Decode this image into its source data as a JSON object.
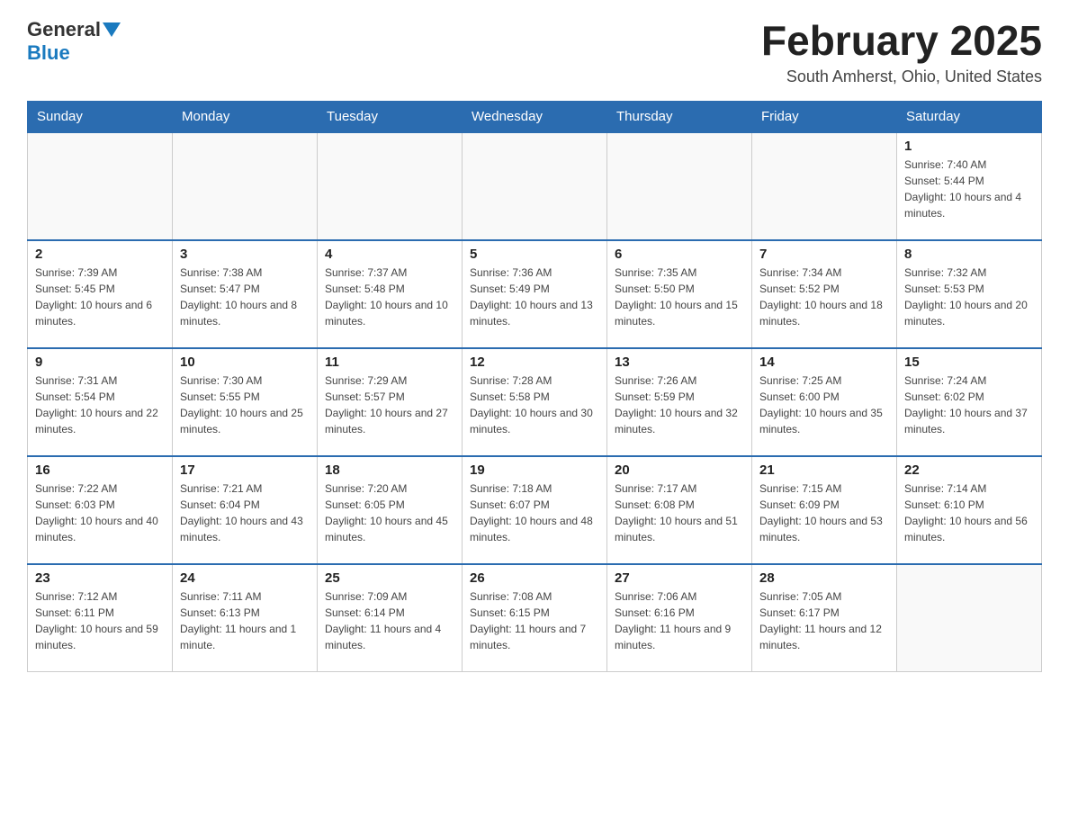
{
  "header": {
    "logo_general": "General",
    "logo_blue": "Blue",
    "month_title": "February 2025",
    "location": "South Amherst, Ohio, United States"
  },
  "weekdays": [
    "Sunday",
    "Monday",
    "Tuesday",
    "Wednesday",
    "Thursday",
    "Friday",
    "Saturday"
  ],
  "weeks": [
    [
      {
        "day": "",
        "info": ""
      },
      {
        "day": "",
        "info": ""
      },
      {
        "day": "",
        "info": ""
      },
      {
        "day": "",
        "info": ""
      },
      {
        "day": "",
        "info": ""
      },
      {
        "day": "",
        "info": ""
      },
      {
        "day": "1",
        "info": "Sunrise: 7:40 AM\nSunset: 5:44 PM\nDaylight: 10 hours and 4 minutes."
      }
    ],
    [
      {
        "day": "2",
        "info": "Sunrise: 7:39 AM\nSunset: 5:45 PM\nDaylight: 10 hours and 6 minutes."
      },
      {
        "day": "3",
        "info": "Sunrise: 7:38 AM\nSunset: 5:47 PM\nDaylight: 10 hours and 8 minutes."
      },
      {
        "day": "4",
        "info": "Sunrise: 7:37 AM\nSunset: 5:48 PM\nDaylight: 10 hours and 10 minutes."
      },
      {
        "day": "5",
        "info": "Sunrise: 7:36 AM\nSunset: 5:49 PM\nDaylight: 10 hours and 13 minutes."
      },
      {
        "day": "6",
        "info": "Sunrise: 7:35 AM\nSunset: 5:50 PM\nDaylight: 10 hours and 15 minutes."
      },
      {
        "day": "7",
        "info": "Sunrise: 7:34 AM\nSunset: 5:52 PM\nDaylight: 10 hours and 18 minutes."
      },
      {
        "day": "8",
        "info": "Sunrise: 7:32 AM\nSunset: 5:53 PM\nDaylight: 10 hours and 20 minutes."
      }
    ],
    [
      {
        "day": "9",
        "info": "Sunrise: 7:31 AM\nSunset: 5:54 PM\nDaylight: 10 hours and 22 minutes."
      },
      {
        "day": "10",
        "info": "Sunrise: 7:30 AM\nSunset: 5:55 PM\nDaylight: 10 hours and 25 minutes."
      },
      {
        "day": "11",
        "info": "Sunrise: 7:29 AM\nSunset: 5:57 PM\nDaylight: 10 hours and 27 minutes."
      },
      {
        "day": "12",
        "info": "Sunrise: 7:28 AM\nSunset: 5:58 PM\nDaylight: 10 hours and 30 minutes."
      },
      {
        "day": "13",
        "info": "Sunrise: 7:26 AM\nSunset: 5:59 PM\nDaylight: 10 hours and 32 minutes."
      },
      {
        "day": "14",
        "info": "Sunrise: 7:25 AM\nSunset: 6:00 PM\nDaylight: 10 hours and 35 minutes."
      },
      {
        "day": "15",
        "info": "Sunrise: 7:24 AM\nSunset: 6:02 PM\nDaylight: 10 hours and 37 minutes."
      }
    ],
    [
      {
        "day": "16",
        "info": "Sunrise: 7:22 AM\nSunset: 6:03 PM\nDaylight: 10 hours and 40 minutes."
      },
      {
        "day": "17",
        "info": "Sunrise: 7:21 AM\nSunset: 6:04 PM\nDaylight: 10 hours and 43 minutes."
      },
      {
        "day": "18",
        "info": "Sunrise: 7:20 AM\nSunset: 6:05 PM\nDaylight: 10 hours and 45 minutes."
      },
      {
        "day": "19",
        "info": "Sunrise: 7:18 AM\nSunset: 6:07 PM\nDaylight: 10 hours and 48 minutes."
      },
      {
        "day": "20",
        "info": "Sunrise: 7:17 AM\nSunset: 6:08 PM\nDaylight: 10 hours and 51 minutes."
      },
      {
        "day": "21",
        "info": "Sunrise: 7:15 AM\nSunset: 6:09 PM\nDaylight: 10 hours and 53 minutes."
      },
      {
        "day": "22",
        "info": "Sunrise: 7:14 AM\nSunset: 6:10 PM\nDaylight: 10 hours and 56 minutes."
      }
    ],
    [
      {
        "day": "23",
        "info": "Sunrise: 7:12 AM\nSunset: 6:11 PM\nDaylight: 10 hours and 59 minutes."
      },
      {
        "day": "24",
        "info": "Sunrise: 7:11 AM\nSunset: 6:13 PM\nDaylight: 11 hours and 1 minute."
      },
      {
        "day": "25",
        "info": "Sunrise: 7:09 AM\nSunset: 6:14 PM\nDaylight: 11 hours and 4 minutes."
      },
      {
        "day": "26",
        "info": "Sunrise: 7:08 AM\nSunset: 6:15 PM\nDaylight: 11 hours and 7 minutes."
      },
      {
        "day": "27",
        "info": "Sunrise: 7:06 AM\nSunset: 6:16 PM\nDaylight: 11 hours and 9 minutes."
      },
      {
        "day": "28",
        "info": "Sunrise: 7:05 AM\nSunset: 6:17 PM\nDaylight: 11 hours and 12 minutes."
      },
      {
        "day": "",
        "info": ""
      }
    ]
  ]
}
